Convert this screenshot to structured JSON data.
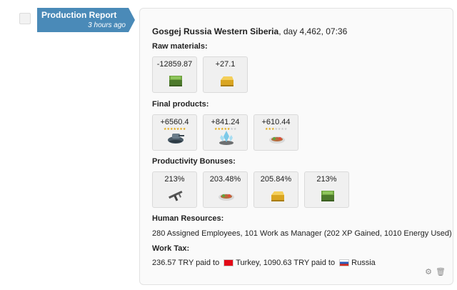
{
  "report": {
    "label": "Production Report",
    "time": "3 hours ago"
  },
  "card": {
    "company": "Gosgej Russia Western Siberia",
    "day_time": ", day 4,462, 07:36",
    "raw_materials": {
      "heading": "Raw materials:",
      "items": [
        {
          "value": "-12859.87",
          "icon": "money-icon"
        },
        {
          "value": "+27.1",
          "icon": "gold-icon"
        }
      ]
    },
    "final_products": {
      "heading": "Final products:",
      "items": [
        {
          "value": "+6560.4",
          "icon": "tank-icon",
          "stars": 7
        },
        {
          "value": "+841.24",
          "icon": "moving-ticket-icon",
          "stars": 5
        },
        {
          "value": "+610.44",
          "icon": "food-icon",
          "stars": 3
        }
      ]
    },
    "bonuses": {
      "heading": "Productivity Bonuses:",
      "items": [
        {
          "value": "213%",
          "icon": "weapon-icon"
        },
        {
          "value": "203.48%",
          "icon": "food-icon"
        },
        {
          "value": "205.84%",
          "icon": "gold-icon"
        },
        {
          "value": "213%",
          "icon": "money-icon"
        }
      ]
    },
    "human_resources": {
      "heading": "Human Resources:",
      "text": "280 Assigned Employees, 101 Work as Manager (202 XP Gained, 1010 Energy Used)"
    },
    "work_tax": {
      "heading": "Work Tax:",
      "part1": "236.57 TRY paid to",
      "country1": "Turkey",
      "part2": ", 1090.63 TRY paid to",
      "country2": "Russia"
    },
    "tools": {
      "share_icon": "gears-icon",
      "delete_icon": "trash-icon"
    }
  }
}
